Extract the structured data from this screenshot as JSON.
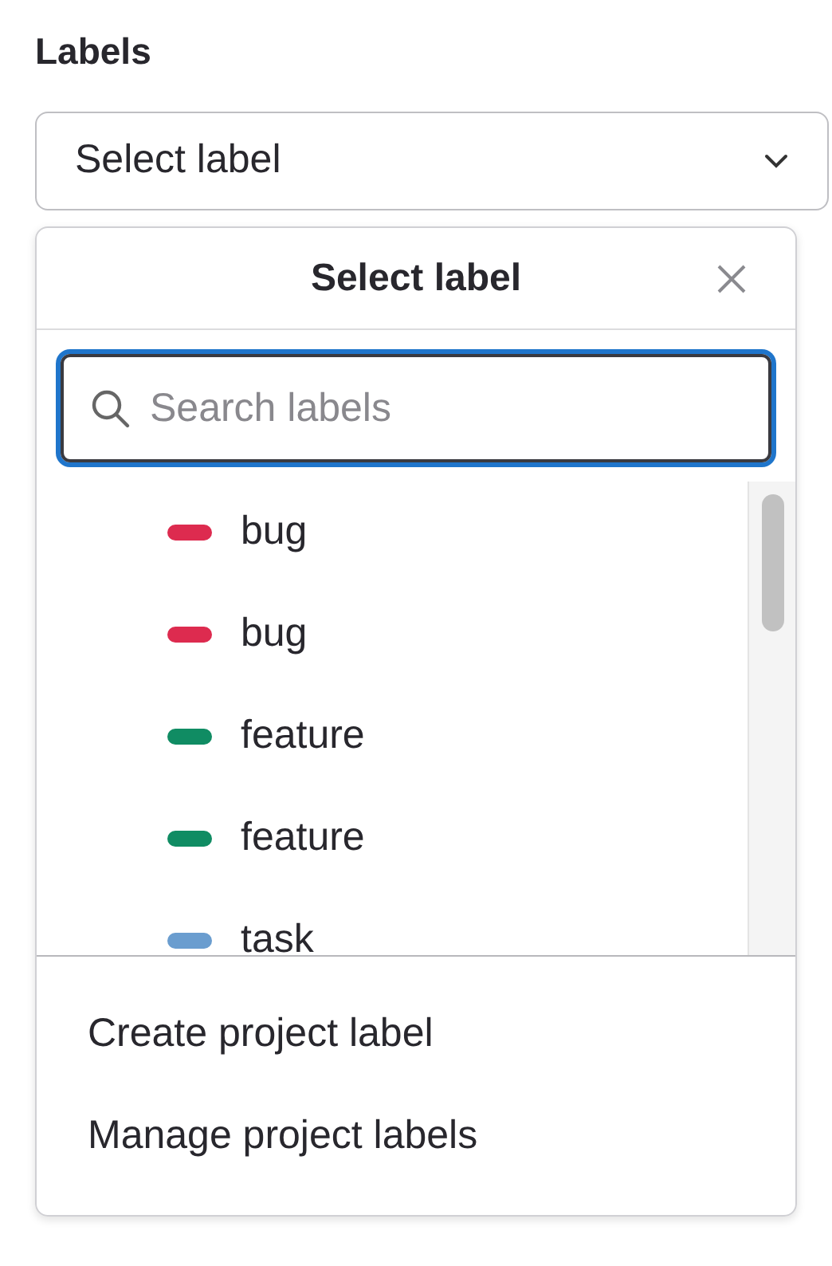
{
  "field_label": "Labels",
  "select": {
    "value": "Select label"
  },
  "dropdown": {
    "title": "Select label",
    "search": {
      "placeholder": "Search labels"
    },
    "labels": [
      {
        "name": "bug",
        "color": "#dd2b4f"
      },
      {
        "name": "bug",
        "color": "#dd2b4f"
      },
      {
        "name": "feature",
        "color": "#108c63"
      },
      {
        "name": "feature",
        "color": "#108c63"
      },
      {
        "name": "task",
        "color": "#6a9dcf"
      }
    ],
    "footer_actions": [
      "Create project label",
      "Manage project labels"
    ]
  }
}
